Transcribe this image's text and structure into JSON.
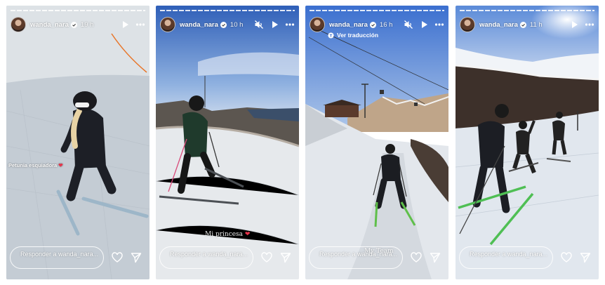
{
  "stories": [
    {
      "username": "wanda_nara",
      "time": "19 h",
      "muted": false,
      "sticker": "Petunia esquiadora",
      "reply_placeholder": "Responder a wanda_nara..."
    },
    {
      "username": "wanda_nara",
      "time": "10 h",
      "muted": true,
      "sticker": "Mi princesa",
      "reply_placeholder": "Responder a wanda_nara..."
    },
    {
      "username": "wanda_nara",
      "time": "16 h",
      "muted": true,
      "translate": "Ver traducción",
      "sticker": "My Team",
      "reply_placeholder": "Responder a wanda_nara..."
    },
    {
      "username": "wanda_nara",
      "time": "11 h",
      "muted": false,
      "reply_placeholder": "Responder a wanda_nara..."
    }
  ],
  "colors": {
    "heart_accent": "#e8334a",
    "sky_blue": "#4a7fd0",
    "snow": "#dfe6ee"
  },
  "icons": [
    "verified-icon",
    "mute-icon",
    "play-icon",
    "more-icon",
    "heart-icon",
    "send-icon",
    "translate-icon"
  ]
}
